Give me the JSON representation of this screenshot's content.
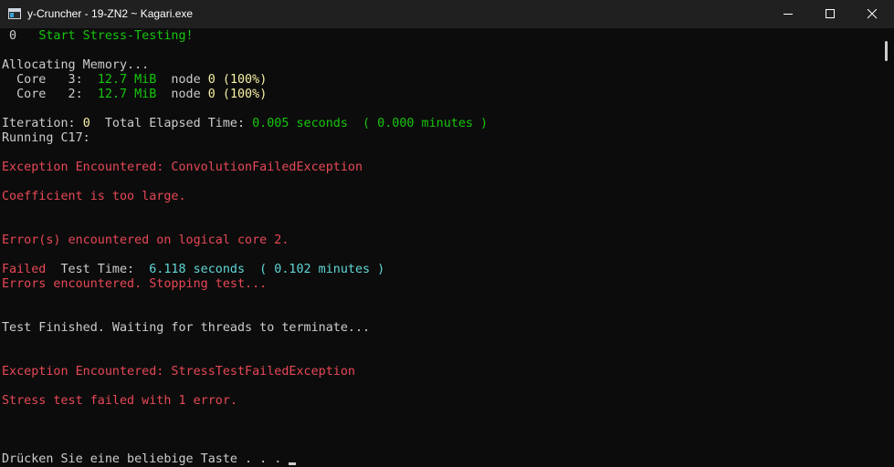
{
  "window": {
    "title": "y-Cruncher - 19-ZN2 ~ Kagari.exe",
    "controls": [
      "minimize",
      "maximize",
      "close"
    ]
  },
  "colors": {
    "green": "#16c60c",
    "yellow": "#f9f1a5",
    "red": "#e74856",
    "cyan": "#61d6d6",
    "default": "#cccccc",
    "background": "#0c0c0c"
  },
  "console": {
    "line_start": [
      {
        "text": " 0   ",
        "color": "w"
      },
      {
        "text": "Start Stress-Testing!",
        "color": "g"
      }
    ],
    "line_alloc": [
      {
        "text": "Allocating Memory...",
        "color": "w"
      }
    ],
    "line_core3": [
      {
        "text": "  Core   3:  ",
        "color": "w"
      },
      {
        "text": "12.7 MiB",
        "color": "g"
      },
      {
        "text": "  node ",
        "color": "w"
      },
      {
        "text": "0",
        "color": "y"
      },
      {
        "text": " (",
        "color": "y"
      },
      {
        "text": "100%",
        "color": "y"
      },
      {
        "text": ")",
        "color": "y"
      }
    ],
    "line_core2": [
      {
        "text": "  Core   2:  ",
        "color": "w"
      },
      {
        "text": "12.7 MiB",
        "color": "g"
      },
      {
        "text": "  node ",
        "color": "w"
      },
      {
        "text": "0",
        "color": "y"
      },
      {
        "text": " (",
        "color": "y"
      },
      {
        "text": "100%",
        "color": "y"
      },
      {
        "text": ")",
        "color": "y"
      }
    ],
    "line_iteration": [
      {
        "text": "Iteration: ",
        "color": "w"
      },
      {
        "text": "0",
        "color": "y"
      },
      {
        "text": "  Total Elapsed Time: ",
        "color": "w"
      },
      {
        "text": "0.005 seconds  ( 0.000 minutes )",
        "color": "g"
      }
    ],
    "line_running": [
      {
        "text": "Running C17:",
        "color": "w"
      }
    ],
    "line_exception1": [
      {
        "text": "Exception Encountered: ConvolutionFailedException",
        "color": "r"
      }
    ],
    "line_coefficient": [
      {
        "text": "Coefficient is too large.",
        "color": "r"
      }
    ],
    "line_errors_core": [
      {
        "text": "Error(s) encountered on logical core 2.",
        "color": "r"
      }
    ],
    "line_failed": [
      {
        "text": "Failed",
        "color": "r"
      },
      {
        "text": "  Test Time:  ",
        "color": "w"
      },
      {
        "text": "6.118 seconds  ( 0.102 minutes )",
        "color": "c"
      }
    ],
    "line_stopping": [
      {
        "text": "Errors encountered. Stopping test...",
        "color": "r"
      }
    ],
    "line_finished": [
      {
        "text": "Test Finished. Waiting for threads to terminate...",
        "color": "w"
      }
    ],
    "line_exception2": [
      {
        "text": "Exception Encountered: StressTestFailedException",
        "color": "r"
      }
    ],
    "line_stress_failed": [
      {
        "text": "Stress test failed with 1 error.",
        "color": "r"
      }
    ],
    "line_press_key": [
      {
        "text": "Drücken Sie eine beliebige Taste . . . ",
        "color": "w"
      }
    ]
  }
}
